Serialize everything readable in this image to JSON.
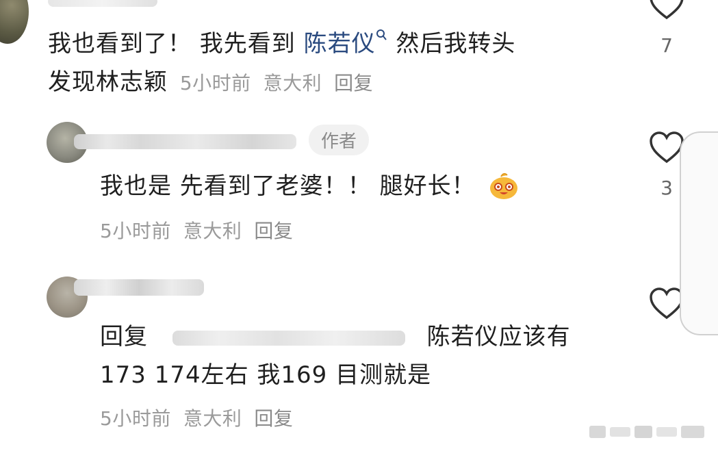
{
  "comments": [
    {
      "text_part1": "我也看到了！ 我先看到 ",
      "link_name": "陈若仪",
      "text_part2": " 然后我转头",
      "text_line2": "发现林志颖",
      "time": "5小时前",
      "location": "意大利",
      "reply": "回复",
      "likes": "7"
    },
    {
      "badge": "作者",
      "text": "我也是 先看到了老婆！！ 腿好长！",
      "time": "5小时前",
      "location": "意大利",
      "reply": "回复",
      "likes": "3"
    },
    {
      "reply_prefix": "回复",
      "text_part1": "陈若仪应该有",
      "text_line2": "173 174左右 我169 目测就是",
      "time": "5小时前",
      "location": "意大利",
      "reply": "回复",
      "likes": ""
    }
  ],
  "icons": {
    "heart": "heart-outline-icon",
    "search": "search-icon",
    "emoji": "smiling-emoji-icon"
  },
  "colors": {
    "link": "#2a4a7f",
    "meta": "#9a9a9a",
    "heart": "#333333"
  }
}
